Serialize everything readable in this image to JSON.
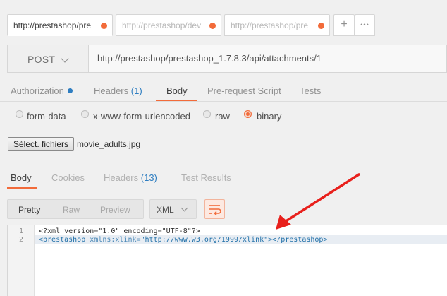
{
  "tabs": [
    {
      "title": "http://prestashop/pre",
      "active": true,
      "dot": true
    },
    {
      "title": "http://prestashop/dev",
      "active": false,
      "dot": true
    },
    {
      "title": "http://prestashop/pre",
      "active": false,
      "dot": true
    }
  ],
  "tab_controls": {
    "add": "+",
    "more": "•••"
  },
  "request": {
    "method": "POST",
    "url": "http://prestashop/prestashop_1.7.8.3/api/attachments/1"
  },
  "request_tabs": [
    {
      "label": "Authorization",
      "dot": true
    },
    {
      "label": "Headers",
      "count": "(1)"
    },
    {
      "label": "Body",
      "active": true
    },
    {
      "label": "Pre-request Script"
    },
    {
      "label": "Tests"
    }
  ],
  "body_types": [
    {
      "label": "form-data",
      "selected": false
    },
    {
      "label": "x-www-form-urlencoded",
      "selected": false
    },
    {
      "label": "raw",
      "selected": false
    },
    {
      "label": "binary",
      "selected": true
    }
  ],
  "file": {
    "button_label": "Sélect. fichiers",
    "filename": "movie_adults.jpg"
  },
  "response_tabs": [
    {
      "label": "Body",
      "active": true
    },
    {
      "label": "Cookies"
    },
    {
      "label": "Headers",
      "count": "(13)"
    },
    {
      "label": "Test Results"
    }
  ],
  "view_modes": [
    {
      "label": "Pretty",
      "active": true
    },
    {
      "label": "Raw"
    },
    {
      "label": "Preview"
    }
  ],
  "format": {
    "selected": "XML"
  },
  "code": {
    "line_numbers": [
      "1",
      "2"
    ],
    "line1": "<?xml version=\"1.0\" encoding=\"UTF-8\"?>",
    "line2_open": "<prestashop",
    "line2_attr": " xmlns:xlink=",
    "line2_str": "\"http://www.w3.org/1999/xlink\"",
    "line2_close": ">",
    "line2_end": "</prestashop>"
  },
  "colors": {
    "accent": "#f26b3a",
    "link_blue": "#2f7ec1",
    "arrow": "#e8201c"
  },
  "icons": [
    "chevron-down-icon",
    "wrap-lines-icon",
    "unsaved-dot-icon",
    "red-arrow-annotation"
  ]
}
